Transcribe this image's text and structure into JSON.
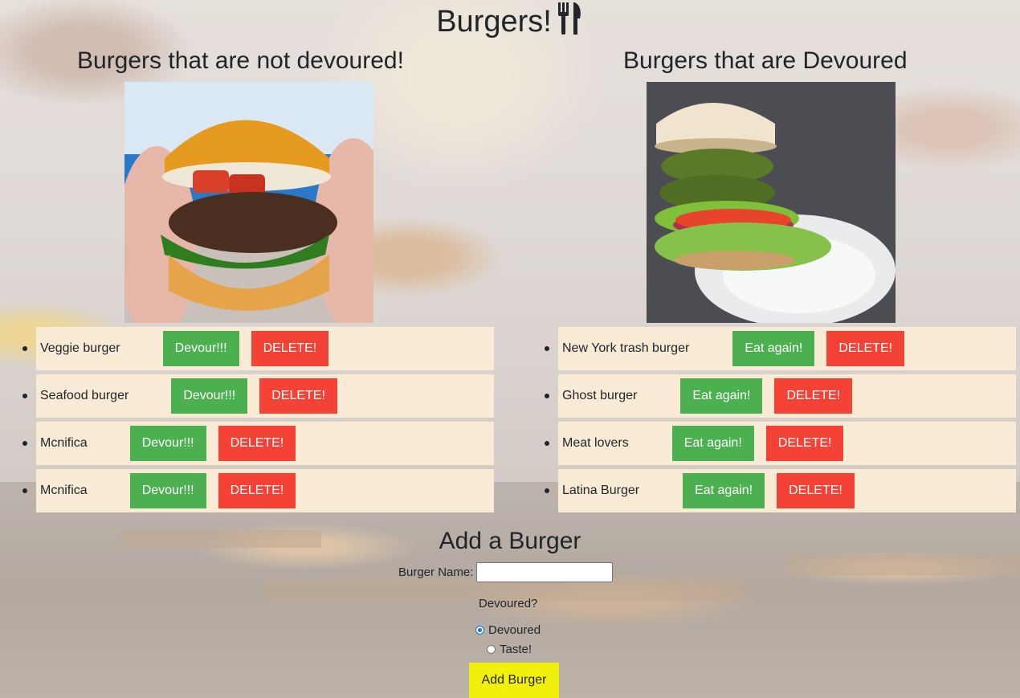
{
  "page": {
    "title": "Burgers!",
    "fork_icon": "utensils-icon"
  },
  "left_column": {
    "heading": "Burgers that are not devoured!",
    "photo_icon": "burger-photo",
    "items": [
      {
        "name": "Veggie burger",
        "action": "Devour!!!",
        "delete": "DELETE!"
      },
      {
        "name": "Seafood burger",
        "action": "Devour!!!",
        "delete": "DELETE!"
      },
      {
        "name": "Mcnifica",
        "action": "Devour!!!",
        "delete": "DELETE!"
      },
      {
        "name": "Mcnifica",
        "action": "Devour!!!",
        "delete": "DELETE!"
      }
    ]
  },
  "right_column": {
    "heading": "Burgers that are Devoured",
    "photo_icon": "veggie-burger-photo",
    "items": [
      {
        "name": "New York trash burger",
        "action": "Eat again!",
        "delete": "DELETE!"
      },
      {
        "name": "Ghost burger",
        "action": "Eat again!",
        "delete": "DELETE!"
      },
      {
        "name": "Meat lovers",
        "action": "Eat again!",
        "delete": "DELETE!"
      },
      {
        "name": "Latina Burger",
        "action": "Eat again!",
        "delete": "DELETE!"
      }
    ]
  },
  "form": {
    "title": "Add a Burger",
    "name_label": "Burger Name:",
    "name_value": "",
    "question": "Devoured?",
    "options": [
      {
        "label": "Devoured",
        "checked": true
      },
      {
        "label": "Taste!",
        "checked": false
      }
    ],
    "submit_label": "Add Burger"
  },
  "colors": {
    "green_button": "#4caf50",
    "red_button": "#f44336",
    "submit_button": "#f0f00a",
    "list_item_bg": "#faebd7"
  }
}
